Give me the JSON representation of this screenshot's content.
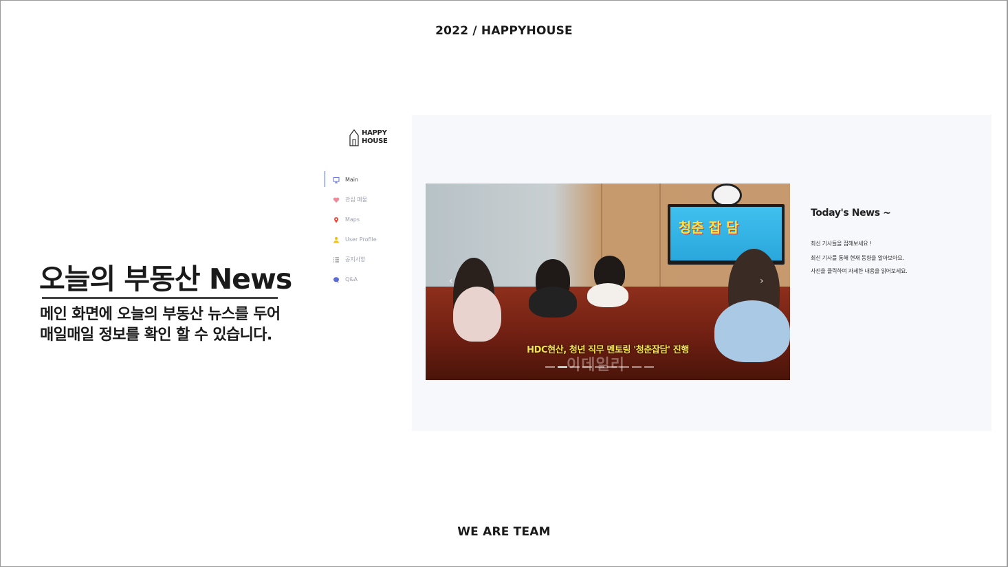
{
  "slide": {
    "top_label": "2022 / HAPPYHOUSE",
    "headline": "오늘의 부동산 News",
    "description": [
      "메인 화면에 오늘의 부동산 뉴스를 두어",
      "매일매일 정보를 확인 할 수 있습니다."
    ],
    "bottom_label": "WE ARE TEAM"
  },
  "app": {
    "logo": {
      "line1": "HAPPY",
      "line2": "HOUSE"
    },
    "nav": [
      {
        "label": "Main",
        "icon": "monitor-icon",
        "color": "#5b6bd5",
        "active": true
      },
      {
        "label": "관심 매물",
        "icon": "heart-icon",
        "color": "#f08a9a",
        "active": false
      },
      {
        "label": "Maps",
        "icon": "map-pin-icon",
        "color": "#e84a3c",
        "active": false
      },
      {
        "label": "User Profile",
        "icon": "user-icon",
        "color": "#f2c21b",
        "active": false
      },
      {
        "label": "공지사항",
        "icon": "list-icon",
        "color": "#666666",
        "active": false
      },
      {
        "label": "Q&A",
        "icon": "chat-bubble-icon",
        "color": "#5b6bd5",
        "active": false
      }
    ],
    "carousel": {
      "caption": "HDC현산, 청년 직무 멘토링 '청춘잡담' 진행",
      "watermark": "이데일리",
      "screen_text": "청춘 잡 담"
    },
    "news": {
      "title": "Today's News ~",
      "lines": [
        "최신 기사들을 접해보세요 !",
        "최신 기사를 통해 현재 동향을 알아보아요.",
        "사진을 클릭하여 자세한 내용을 읽어보세요."
      ]
    }
  }
}
